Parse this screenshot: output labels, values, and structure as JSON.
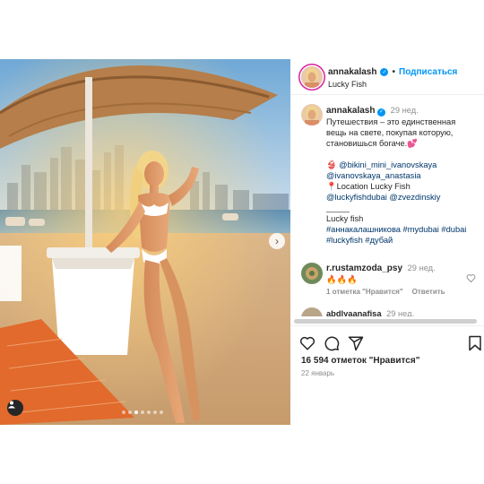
{
  "post": {
    "author": "annakalash",
    "follow_label": "Подписаться",
    "separator": "•",
    "location": "Lucky Fish",
    "caption_time": "29 нед.",
    "caption_lines": [
      "Путешествия – это единственная",
      "вещь на свете, покупая которую,",
      "становишься богаче.💕"
    ],
    "caption_links": [
      "👙 @bikini_mini_ivanovskaya",
      "@ivanovskaya_anastasia"
    ],
    "location_line": "📍Location Lucky Fish",
    "location_links": "@luckyfishdubai @zvezdinskiy",
    "divider_text": "_____",
    "place_name": "Lucky fish",
    "hashtags_1": "#аннакалашникова #mydubai #dubai",
    "hashtags_2": "#luckyfish #дубай"
  },
  "comments": [
    {
      "user": "r.rustamzoda_psy",
      "time": "29 нед.",
      "text": "🔥🔥🔥",
      "likes_label": "1 отметка \"Нравится\"",
      "reply_label": "Ответить"
    },
    {
      "user": "abdlyaanafisa",
      "time": "29 нед."
    }
  ],
  "footer": {
    "likes": "16 594 отметок \"Нравится\"",
    "date": "22 январь"
  },
  "icons": {
    "verified": "verified-badge-icon",
    "like": "heart-icon",
    "comment": "comment-icon",
    "share": "share-icon",
    "save": "bookmark-icon",
    "next": "chevron-right-icon",
    "tags": "user-tag-icon"
  },
  "colors": {
    "accent": "#0095f6",
    "link": "#00376b",
    "muted": "#8e8e8e",
    "text": "#262626"
  },
  "carousel": {
    "slides": 7,
    "active": 2
  }
}
